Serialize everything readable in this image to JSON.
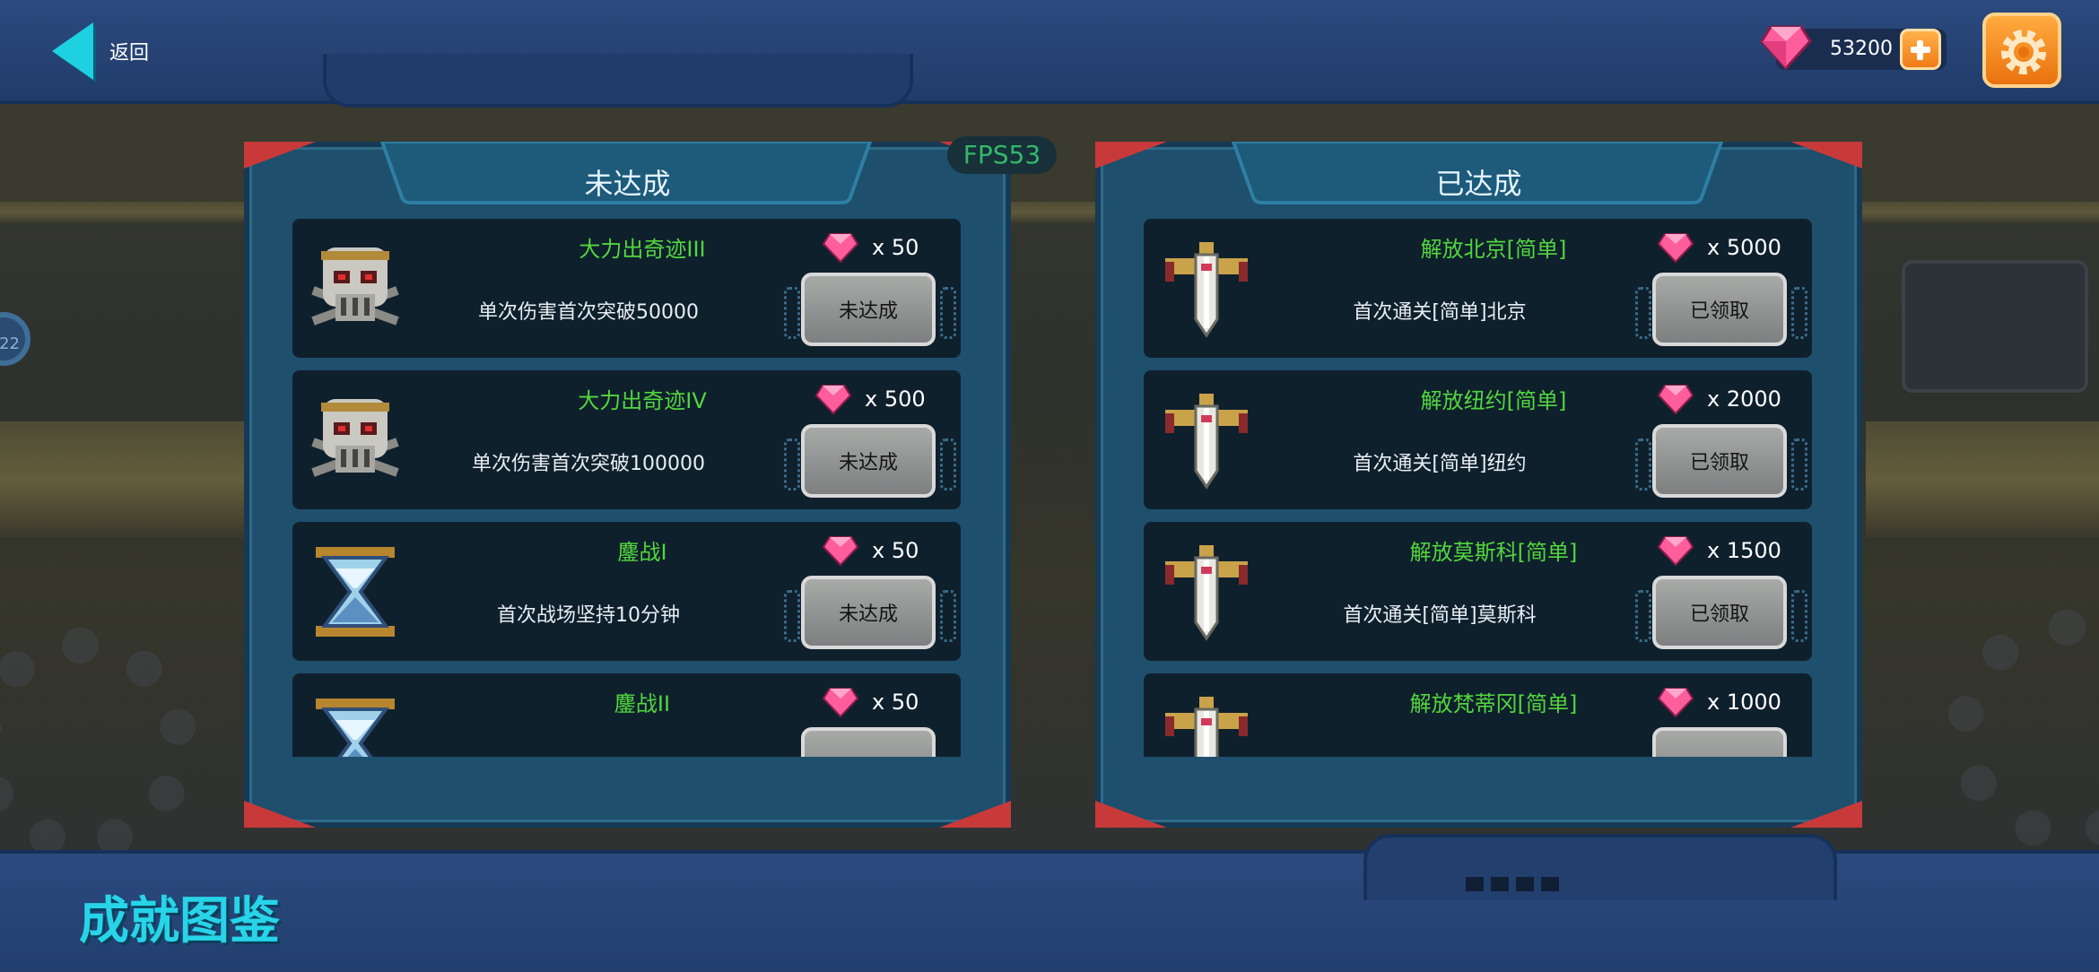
{
  "header": {
    "back_label": "返回",
    "gem_count": "53200"
  },
  "fps_label": "FPS53",
  "left_panel": {
    "title": "未达成",
    "items": [
      {
        "name": "大力出奇迹III",
        "reward": "x 50",
        "desc": "单次伤害首次突破50000",
        "button": "未达成",
        "icon": "skull-icon"
      },
      {
        "name": "大力出奇迹IV",
        "reward": "x 500",
        "desc": "单次伤害首次突破100000",
        "button": "未达成",
        "icon": "skull-icon"
      },
      {
        "name": "鏖战I",
        "reward": "x 50",
        "desc": "首次战场坚持10分钟",
        "button": "未达成",
        "icon": "hourglass-icon"
      },
      {
        "name": "鏖战II",
        "reward": "x 50",
        "desc": "",
        "button": "",
        "icon": "hourglass-icon"
      }
    ]
  },
  "right_panel": {
    "title": "已达成",
    "items": [
      {
        "name": "解放北京[简单]",
        "reward": "x 5000",
        "desc": "首次通关[简单]北京",
        "button": "已领取",
        "icon": "sword-icon"
      },
      {
        "name": "解放纽约[简单]",
        "reward": "x 2000",
        "desc": "首次通关[简单]纽约",
        "button": "已领取",
        "icon": "sword-icon"
      },
      {
        "name": "解放莫斯科[简单]",
        "reward": "x 1500",
        "desc": "首次通关[简单]莫斯科",
        "button": "已领取",
        "icon": "sword-icon"
      },
      {
        "name": "解放梵蒂冈[简单]",
        "reward": "x 1000",
        "desc": "",
        "button": "",
        "icon": "sword-icon"
      }
    ]
  },
  "footer": {
    "title": "成就图鉴"
  },
  "colors": {
    "achievement_name": "#53d63d",
    "title_cyan": "#27d4e8",
    "button_gray": "#a8aaa8",
    "accent_orange": "#f07b17"
  }
}
